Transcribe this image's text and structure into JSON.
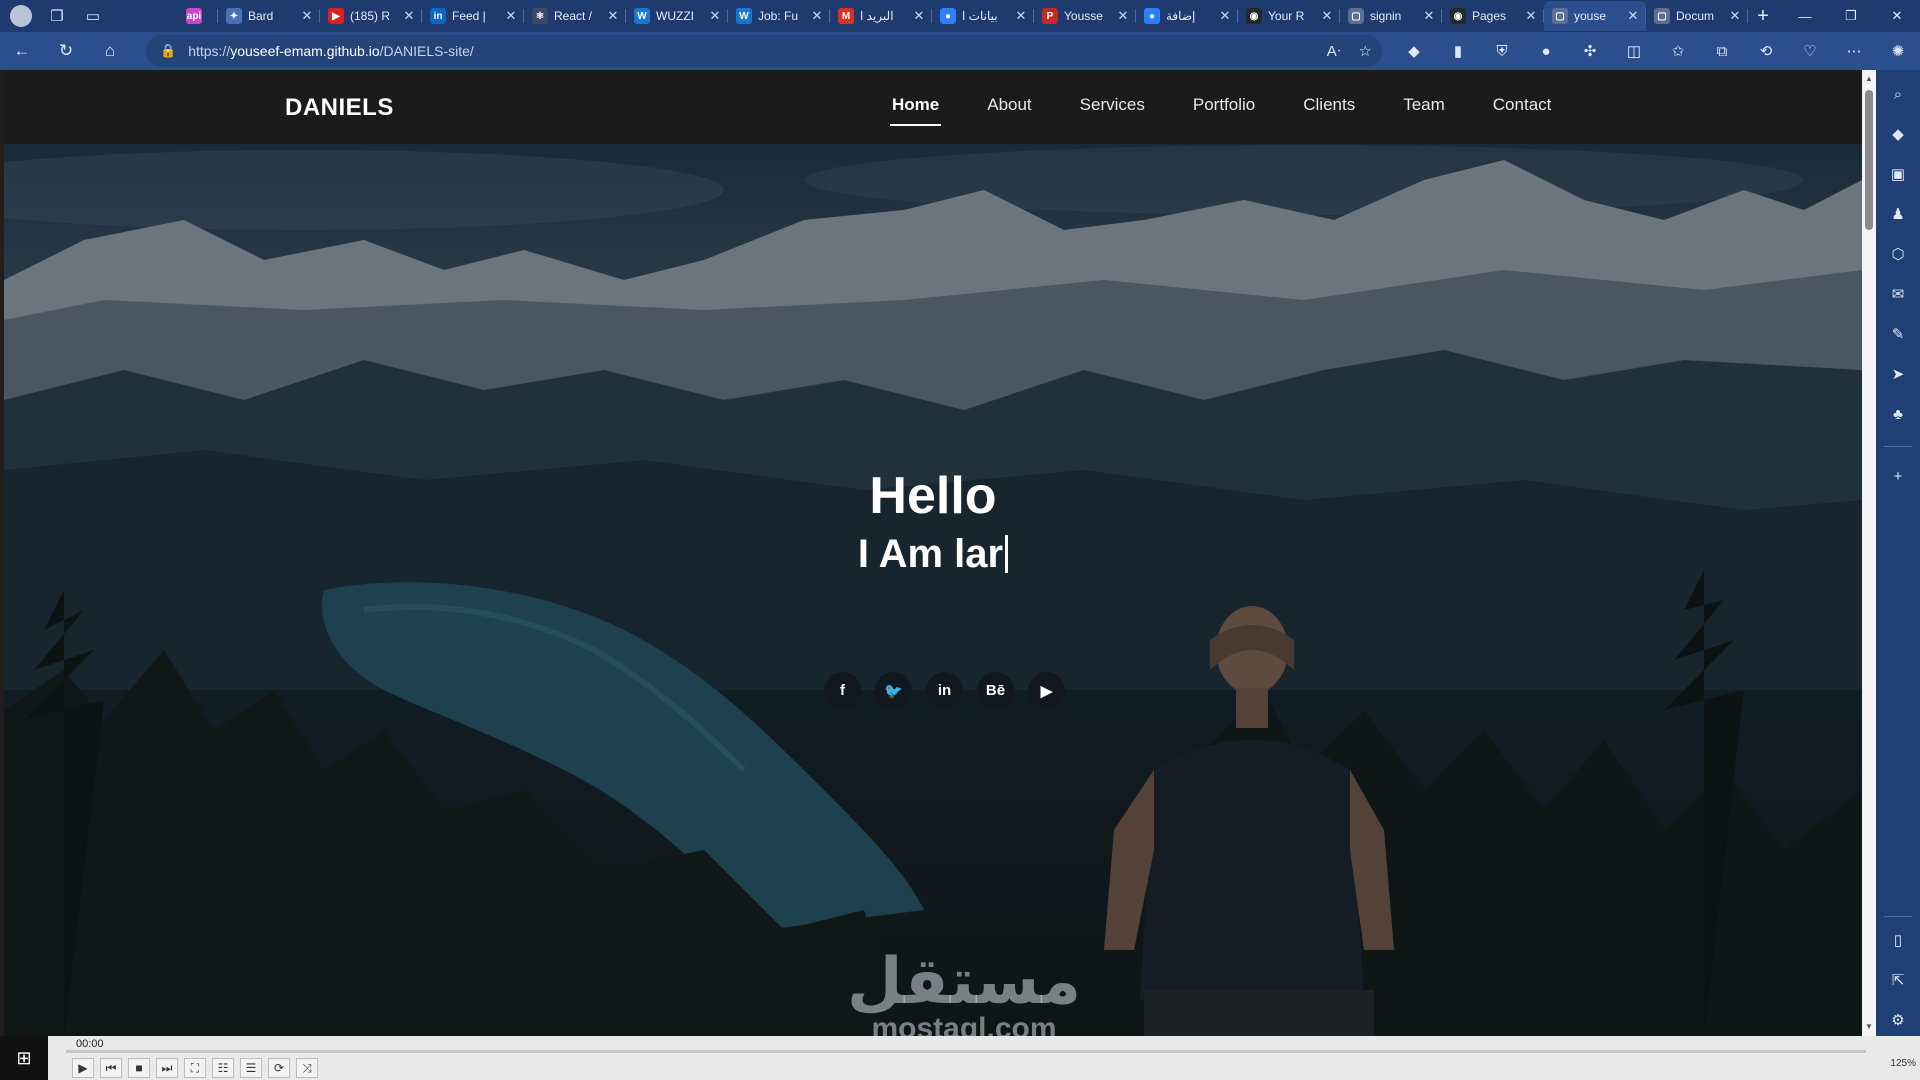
{
  "browser": {
    "tabs": [
      {
        "title": "",
        "favicon": "app-icon",
        "color": "#c847c8",
        "fav_text": "api",
        "narrow": true
      },
      {
        "title": "Bard",
        "favicon": "bard-icon",
        "color": "#4a6fb5",
        "fav_text": "✦"
      },
      {
        "title": "(185) R",
        "favicon": "youtube-icon",
        "color": "#e02020",
        "fav_text": "▶"
      },
      {
        "title": "Feed |",
        "favicon": "linkedin-icon",
        "color": "#0a66c2",
        "fav_text": "in"
      },
      {
        "title": "React /",
        "favicon": "react-icon",
        "color": "#3a4a66",
        "fav_text": "⚛"
      },
      {
        "title": "WUZZI",
        "favicon": "wuzzuf-icon",
        "color": "#1976d2",
        "fav_text": "W"
      },
      {
        "title": "Job: Fu",
        "favicon": "wuzzuf-icon",
        "color": "#1976d2",
        "fav_text": "W"
      },
      {
        "title": "البريد ا",
        "favicon": "gmail-icon",
        "color": "#d93025",
        "fav_text": "M"
      },
      {
        "title": "بيانات ا",
        "favicon": "circle-app-icon",
        "color": "#2d7ff9",
        "fav_text": "●"
      },
      {
        "title": "Yousse",
        "favicon": "pdf-icon",
        "color": "#c62828",
        "fav_text": "P"
      },
      {
        "title": "إضافة",
        "favicon": "circle-app-icon",
        "color": "#2d7ff9",
        "fav_text": "●"
      },
      {
        "title": "Your R",
        "favicon": "github-icon",
        "color": "#24292e",
        "fav_text": "◉"
      },
      {
        "title": "signin",
        "favicon": "page-icon",
        "color": "#5b6f94",
        "fav_text": "▢"
      },
      {
        "title": "Pages",
        "favicon": "github-icon",
        "color": "#24292e",
        "fav_text": "◉"
      },
      {
        "title": "youse",
        "favicon": "page-icon",
        "color": "#5b6f94",
        "fav_text": "▢",
        "active": true
      },
      {
        "title": "Docum",
        "favicon": "page-icon",
        "color": "#5b6f94",
        "fav_text": "▢"
      }
    ],
    "close_glyph": "✕",
    "url_prefix": "https://",
    "url_host": "youseef-emam.github.io",
    "url_path": "/DANIELS-site/"
  },
  "site": {
    "logo": "DANIELS",
    "menu": [
      "Home",
      "About",
      "Services",
      "Portfolio",
      "Clients",
      "Team",
      "Contact"
    ],
    "active_menu": "Home",
    "hero_title": "Hello",
    "hero_subtitle": "I Am lar",
    "social": [
      {
        "name": "facebook-icon",
        "glyph": "f"
      },
      {
        "name": "twitter-icon",
        "glyph": "🐦"
      },
      {
        "name": "linkedin-icon",
        "glyph": "in"
      },
      {
        "name": "behance-icon",
        "glyph": "Bē"
      },
      {
        "name": "youtube-icon",
        "glyph": "▶"
      }
    ]
  },
  "watermark": {
    "arabic": "مستقل",
    "latin": "mostaql.com"
  },
  "media_player": {
    "time": "00:00",
    "zoom": "125%"
  }
}
